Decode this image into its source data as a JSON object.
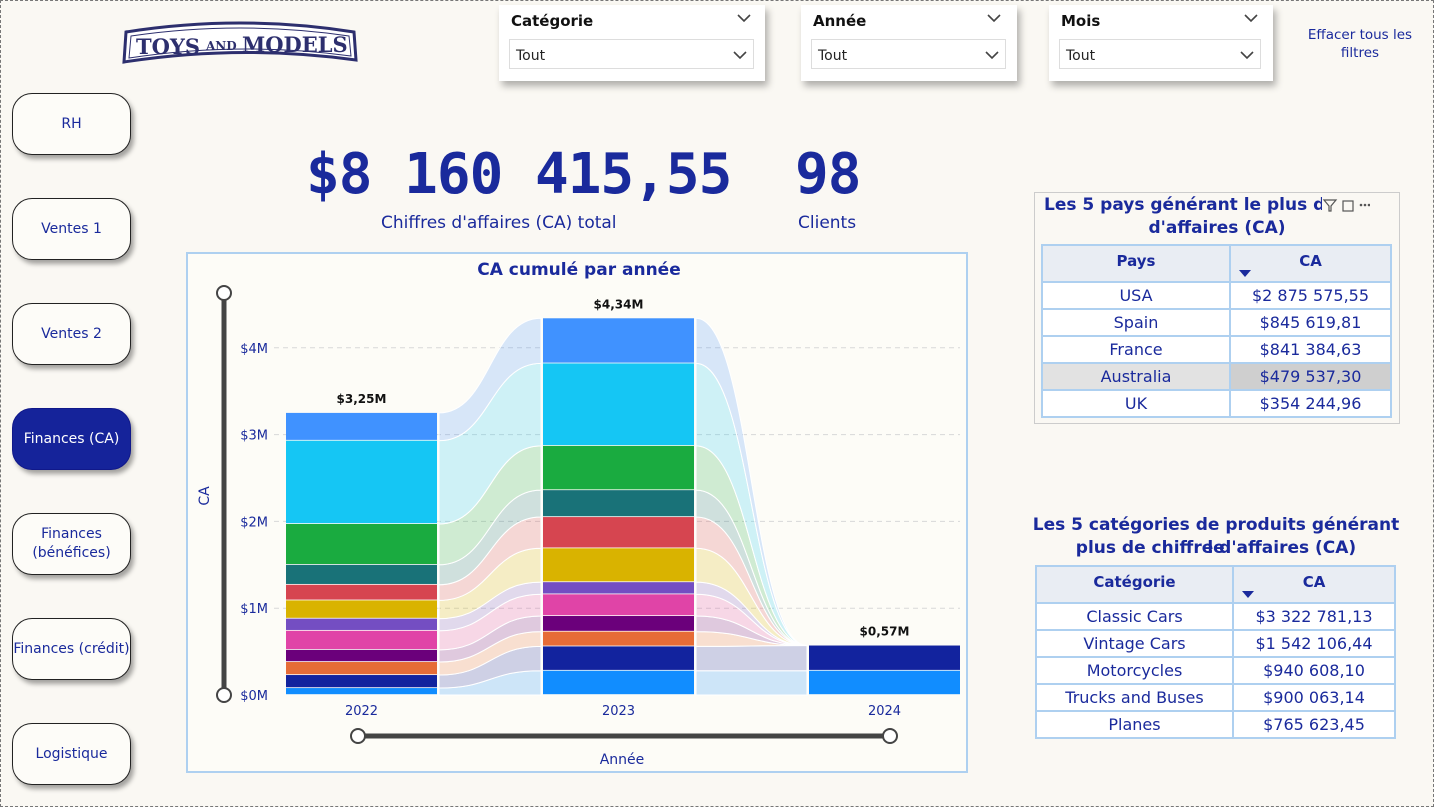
{
  "logo": {
    "text_main": "TOYS",
    "text_and": "AND",
    "text_models": "MODELS"
  },
  "nav": {
    "items": [
      {
        "label": "RH",
        "active": false
      },
      {
        "label": "Ventes 1",
        "active": false
      },
      {
        "label": "Ventes 2",
        "active": false
      },
      {
        "label": "Finances (CA)",
        "active": true
      },
      {
        "label": "Finances (bénéfices)",
        "active": false
      },
      {
        "label": "Finances (crédit)",
        "active": false
      },
      {
        "label": "Logistique",
        "active": false
      }
    ]
  },
  "filters": {
    "category": {
      "title": "Catégorie",
      "value": "Tout"
    },
    "year": {
      "title": "Année",
      "value": "Tout"
    },
    "month": {
      "title": "Mois",
      "value": "Tout"
    },
    "clear_label": "Effacer tous les filtres"
  },
  "kpis": {
    "revenue": {
      "value": "$8 160 415,55",
      "label": "Chiffres d'affaires (CA) total"
    },
    "clients": {
      "value": "98",
      "label": "Clients"
    }
  },
  "chart_data": {
    "type": "bar",
    "title": "CA cumulé par année",
    "xlabel": "Année",
    "ylabel": "CA",
    "ylim": [
      0,
      4.34
    ],
    "y_ticks": [
      "$0M",
      "$1M",
      "$2M",
      "$3M",
      "$4M"
    ],
    "categories": [
      "2022",
      "2023",
      "2024"
    ],
    "totals_labels": [
      "$3,25M",
      "$4,34M",
      "$0,57M"
    ],
    "totals": [
      3.25,
      4.34,
      0.57
    ],
    "colors": [
      "#118dff",
      "#12239e",
      "#e66c37",
      "#6b007b",
      "#e044a7",
      "#744ec2",
      "#d9b300",
      "#d64550",
      "#197278",
      "#1aab40",
      "#15c6f4",
      "#4092ff"
    ],
    "series": [
      {
        "values": [
          0.08,
          0.28,
          0.28
        ]
      },
      {
        "values": [
          0.15,
          0.28,
          0.29
        ]
      },
      {
        "values": [
          0.15,
          0.17,
          0
        ]
      },
      {
        "values": [
          0.14,
          0.18,
          0
        ]
      },
      {
        "values": [
          0.22,
          0.25,
          0
        ]
      },
      {
        "values": [
          0.14,
          0.14,
          0
        ]
      },
      {
        "values": [
          0.21,
          0.39,
          0
        ]
      },
      {
        "values": [
          0.18,
          0.36,
          0
        ]
      },
      {
        "values": [
          0.23,
          0.31,
          0
        ]
      },
      {
        "values": [
          0.47,
          0.51,
          0
        ]
      },
      {
        "values": [
          0.96,
          0.95,
          0
        ]
      },
      {
        "values": [
          0.32,
          0.52,
          0
        ]
      }
    ]
  },
  "top_countries": {
    "title": "Les 5 pays générant le plus de chiffre d'affaires (CA)",
    "title_visible_line1": "Les 5 pays générant le plus de",
    "title_visible_line2": "d'affaires (CA)",
    "headers": [
      "Pays",
      "CA"
    ],
    "rows": [
      {
        "name": "USA",
        "value": "$2 875 575,55"
      },
      {
        "name": "Spain",
        "value": "$845 619,81"
      },
      {
        "name": "France",
        "value": "$841 384,63"
      },
      {
        "name": "Australia",
        "value": "$479 537,30"
      },
      {
        "name": "UK",
        "value": "$354 244,96"
      }
    ]
  },
  "top_categories": {
    "title_line1": "Les 5 catégories de produits générant le",
    "title_line2": "plus de chiffre d'affaires (CA)",
    "headers": [
      "Catégorie",
      "CA"
    ],
    "rows": [
      {
        "name": "Classic Cars",
        "value": "$3 322 781,13"
      },
      {
        "name": "Vintage Cars",
        "value": "$1 542 106,44"
      },
      {
        "name": "Motorcycles",
        "value": "$940 608,10"
      },
      {
        "name": "Trucks and Buses",
        "value": "$900 063,14"
      },
      {
        "name": "Planes",
        "value": "$765 623,45"
      }
    ]
  }
}
